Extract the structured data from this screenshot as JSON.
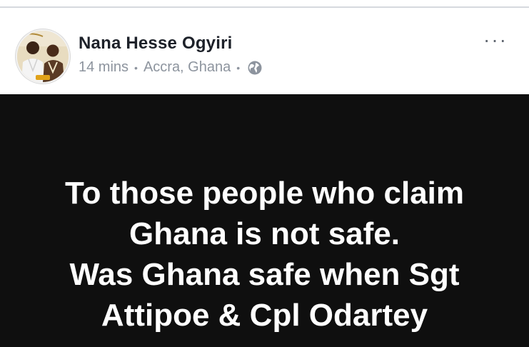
{
  "post": {
    "author": "Nana Hesse Ogyiri",
    "time": "14 mins",
    "location": "Accra, Ghana",
    "audience_icon": "globe-icon",
    "more_icon": "more-options-icon",
    "more_label": "···"
  },
  "content": {
    "lines": [
      "To those people who claim",
      "Ghana is not safe.",
      "Was Ghana safe when Sgt",
      "Attipoe & Cpl Odartey"
    ],
    "background_color": "#0f0f0f",
    "text_color": "#ffffff"
  }
}
